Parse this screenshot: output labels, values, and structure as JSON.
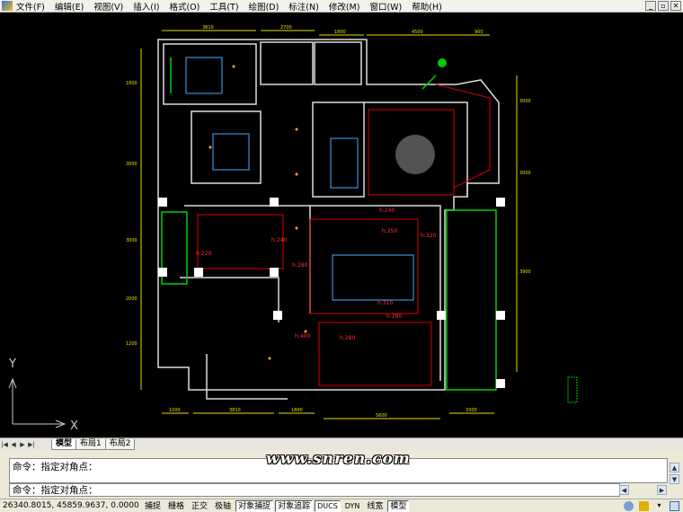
{
  "menu": [
    "文件(F)",
    "编辑(E)",
    "视图(V)",
    "插入(I)",
    "格式(O)",
    "工具(T)",
    "绘图(D)",
    "标注(N)",
    "修改(M)",
    "窗口(W)",
    "帮助(H)"
  ],
  "window_controls": [
    "_",
    "▫",
    "✕"
  ],
  "drawing": {
    "dims_top": [
      "3810",
      "2700",
      "1800",
      "4500",
      "900"
    ],
    "dims_bottom": [
      "1000",
      "3810",
      "1800",
      "5600",
      "3300"
    ],
    "dims_left": [
      "1800",
      "3000",
      "3000",
      "2000",
      "1200"
    ],
    "dims_right": [
      "3000",
      "3000",
      "3900"
    ],
    "heights": [
      "h:240",
      "h:240",
      "h:220",
      "h:280",
      "h:320",
      "h:250",
      "h:310",
      "h:400",
      "h:280",
      "h:280"
    ],
    "ucs": {
      "x": "X",
      "y": "Y"
    }
  },
  "tabs": {
    "nav": [
      "|◀",
      "◀",
      "▶",
      "▶|"
    ],
    "items": [
      "模型",
      "布局1",
      "布局2"
    ],
    "active": "模型"
  },
  "command": {
    "line1": "命令：指定对角点：",
    "line2": "命令：指定对角点：",
    "watermark": "www.snren.com"
  },
  "status": {
    "coords": "26340.8015, 45859.9637, 0.0000",
    "buttons": [
      {
        "label": "捕捉",
        "on": false
      },
      {
        "label": "栅格",
        "on": false
      },
      {
        "label": "正交",
        "on": false
      },
      {
        "label": "极轴",
        "on": false
      },
      {
        "label": "对象捕捉",
        "on": true
      },
      {
        "label": "对象追踪",
        "on": true
      },
      {
        "label": "DUCS",
        "on": true
      },
      {
        "label": "DYN",
        "on": false
      },
      {
        "label": "线宽",
        "on": false
      },
      {
        "label": "模型",
        "on": true
      }
    ]
  }
}
